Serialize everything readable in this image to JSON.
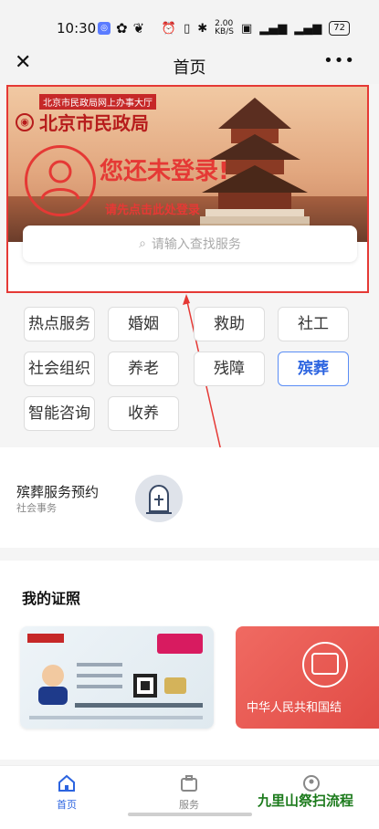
{
  "status_bar": {
    "time": "10:30",
    "network_speed": "2.00",
    "network_unit": "KB/S",
    "battery": "72"
  },
  "nav": {
    "title": "首页"
  },
  "banner": {
    "org_small": "北京市民政局网上办事大厅",
    "org_name": "北京市民政局",
    "login_title": "您还未登录!",
    "login_sub": "请先点击此处登录",
    "search_placeholder": "请输入查找服务"
  },
  "categories": [
    {
      "label": "热点服务",
      "active": false
    },
    {
      "label": "婚姻",
      "active": false
    },
    {
      "label": "救助",
      "active": false
    },
    {
      "label": "社工",
      "active": false
    },
    {
      "label": "社会组织",
      "active": false
    },
    {
      "label": "养老",
      "active": false
    },
    {
      "label": "残障",
      "active": false
    },
    {
      "label": "殡葬",
      "active": true
    },
    {
      "label": "智能咨询",
      "active": false
    },
    {
      "label": "收养",
      "active": false
    }
  ],
  "service": {
    "name": "殡葬服务预约",
    "category": "社会事务"
  },
  "certificates": {
    "heading": "我的证照",
    "card2_title": "中华人民共和国结"
  },
  "tabbar": {
    "home": "首页",
    "service": "服务"
  },
  "watermark": "九里山祭扫流程",
  "colors": {
    "accent": "#2c64e0",
    "highlight_red": "#e53935"
  }
}
